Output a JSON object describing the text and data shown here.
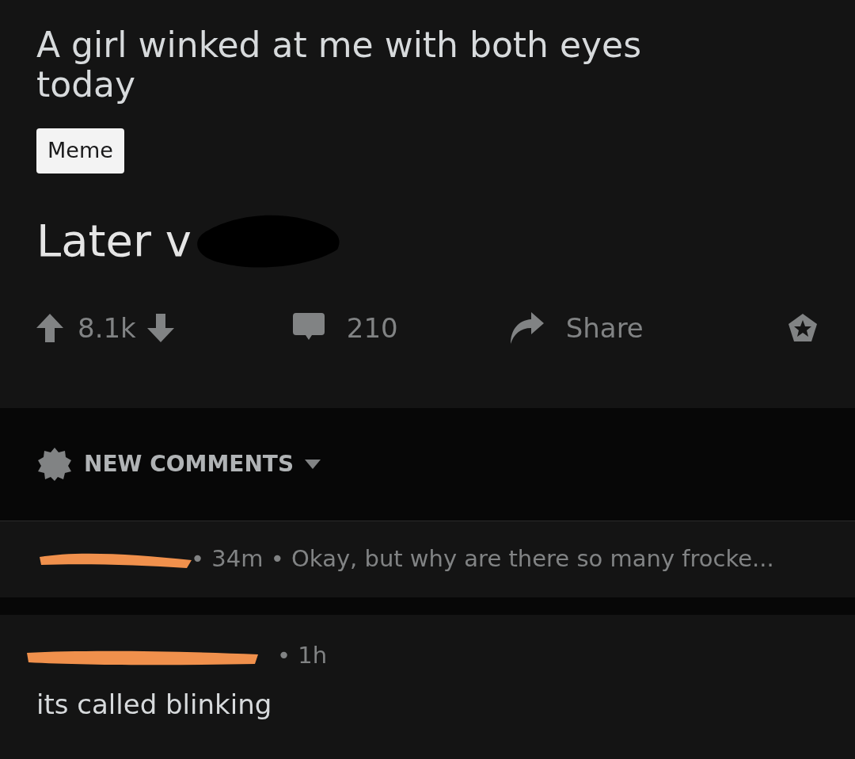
{
  "post": {
    "title": "A girl winked at me with both eyes today",
    "flair": "Meme",
    "body": "Later v",
    "votes": "8.1k",
    "comments": "210",
    "share": "Share"
  },
  "sort": {
    "label": "NEW COMMENTS"
  },
  "comments": [
    {
      "kind": "collapsed",
      "meta": "• 34m • Okay, but why are there so many frocke..."
    },
    {
      "kind": "expanded",
      "meta": "• 1h",
      "body": "its called blinking"
    }
  ]
}
